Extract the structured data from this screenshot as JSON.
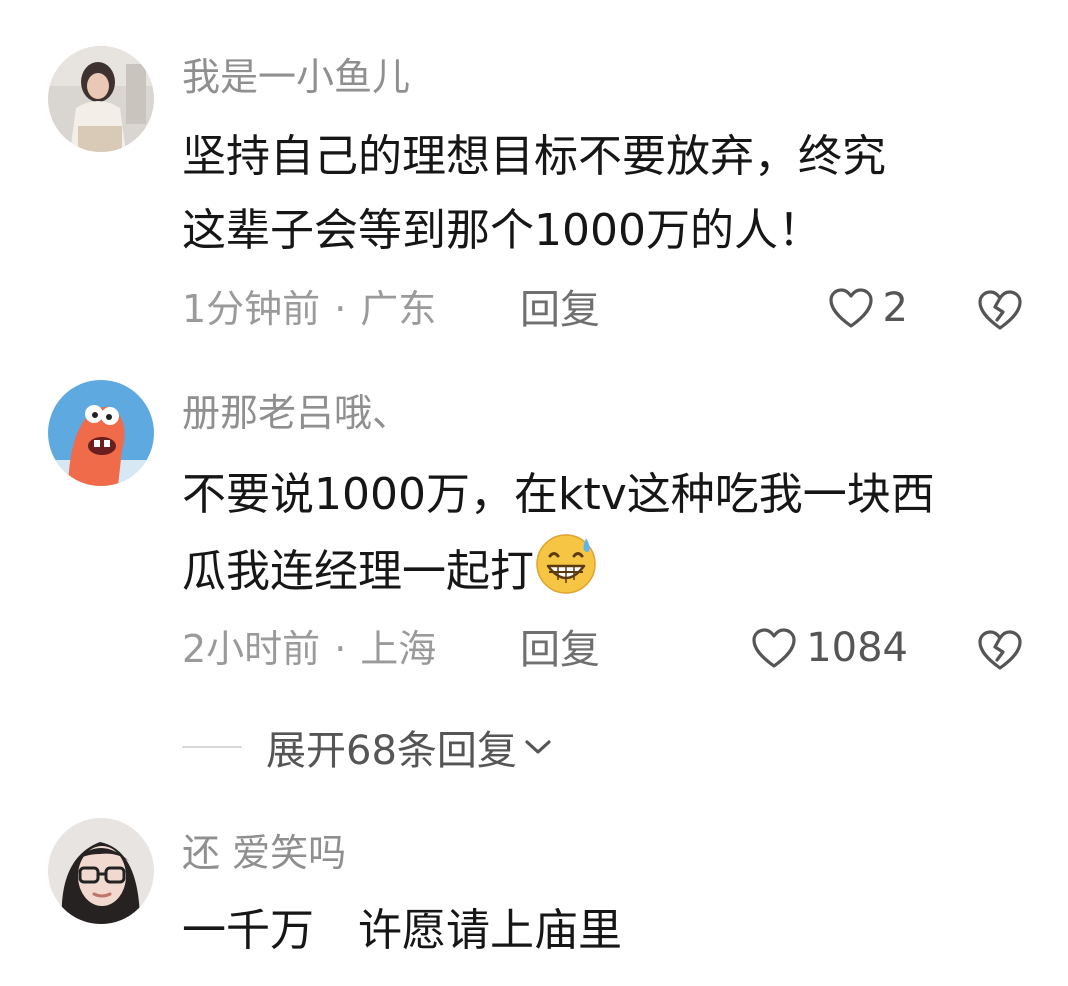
{
  "comments": [
    {
      "username": "我是一小鱼儿",
      "text_lines": [
        "坚持自己的理想目标不要放弃，终究",
        "这辈子会等到那个1000万的人！"
      ],
      "time": "1分钟前",
      "location": "广东",
      "reply_label": "回复",
      "likes": "2"
    },
    {
      "username": "册那老吕哦、",
      "text_lines": [
        "不要说1000万，在ktv这种吃我一块西",
        "瓜我连经理一起打"
      ],
      "time": "2小时前",
      "location": "上海",
      "reply_label": "回复",
      "likes": "1084",
      "emoji": "grinning-sweat-emoji"
    },
    {
      "username": "还 爱笑吗",
      "text_lines": [
        "一千万　许愿请上庙里"
      ]
    }
  ],
  "expand_replies": {
    "label": "展开68条回复"
  },
  "meta_separator": "·",
  "icons": {
    "like": "heart-outline-icon",
    "dislike": "broken-heart-icon",
    "expand": "chevron-down-icon"
  },
  "colors": {
    "username": "#8f8f8f",
    "text": "#161616",
    "meta": "#9a9a9a",
    "emoji_face": "#f6c543"
  }
}
